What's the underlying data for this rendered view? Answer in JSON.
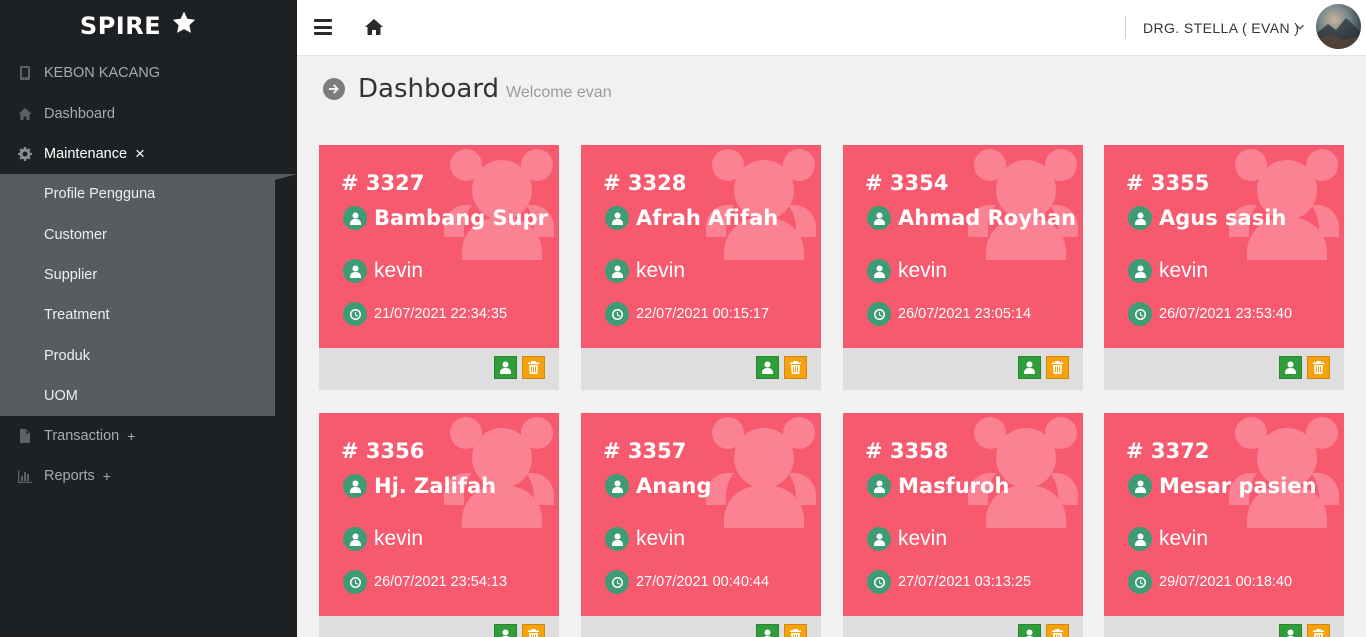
{
  "brand": {
    "name": "SPIRE",
    "icon": "star-icon"
  },
  "sidebar": {
    "items": [
      {
        "label": "KEBON KACANG",
        "icon": "tablet-icon",
        "toggle": ""
      },
      {
        "label": "Dashboard",
        "icon": "home-icon",
        "toggle": ""
      },
      {
        "label": "Maintenance",
        "icon": "gear-icon",
        "toggle": "×"
      },
      {
        "label": "Transaction",
        "icon": "file-icon",
        "toggle": "+"
      },
      {
        "label": "Reports",
        "icon": "bar-chart-icon",
        "toggle": "+"
      }
    ],
    "submenu": [
      "Profile Pengguna",
      "Customer",
      "Supplier",
      "Treatment",
      "Produk",
      "UOM"
    ]
  },
  "topbar": {
    "user_name": "DRG. STELLA ( EVAN )"
  },
  "page": {
    "title": "Dashboard",
    "subtitle": "Welcome evan"
  },
  "cards": [
    {
      "number": "# 3327",
      "patient": "Bambang Supr",
      "staff": "kevin",
      "datetime": "21/07/2021 22:34:35"
    },
    {
      "number": "# 3328",
      "patient": "Afrah Afifah",
      "staff": "kevin",
      "datetime": "22/07/2021 00:15:17"
    },
    {
      "number": "# 3354",
      "patient": "Ahmad Royhan",
      "staff": "kevin",
      "datetime": "26/07/2021 23:05:14"
    },
    {
      "number": "# 3355",
      "patient": "Agus sasih",
      "staff": "kevin",
      "datetime": "26/07/2021 23:53:40"
    },
    {
      "number": "# 3356",
      "patient": "Hj. Zalifah",
      "staff": "kevin",
      "datetime": "26/07/2021 23:54:13"
    },
    {
      "number": "# 3357",
      "patient": "Anang",
      "staff": "kevin",
      "datetime": "27/07/2021 00:40:44"
    },
    {
      "number": "# 3358",
      "patient": "Masfuroh",
      "staff": "kevin",
      "datetime": "27/07/2021 03:13:25"
    },
    {
      "number": "# 3372",
      "patient": "Mesar pasien",
      "staff": "kevin",
      "datetime": "29/07/2021 00:18:40"
    }
  ],
  "colors": {
    "card": "#f7596e",
    "sidebar": "#1d2123",
    "submenu": "#585c5e",
    "badge": "#3e9c74",
    "btn_green": "#2f9d3a",
    "btn_orange": "#f5a20e"
  }
}
